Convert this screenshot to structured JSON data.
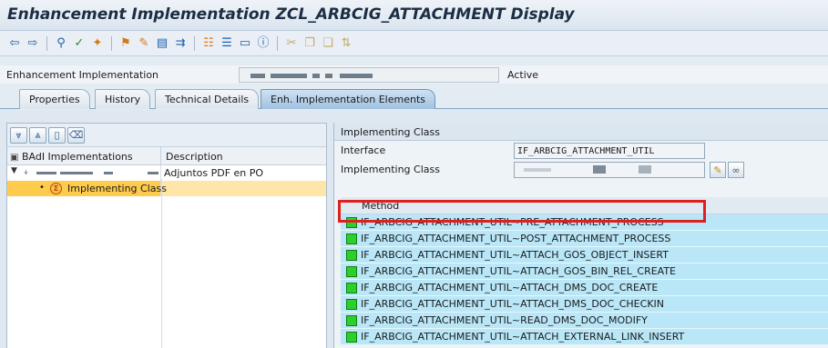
{
  "title": "Enhancement Implementation ZCL_ARBCIG_ATTACHMENT Display",
  "toolbar": {
    "icons": [
      "back-arrow-icon",
      "forward-arrow-icon",
      "other-object-icon",
      "check-icon",
      "activate-icon",
      "where-used-icon",
      "edit-pencil-icon",
      "display-change-icon",
      "transport-icon",
      "hierarchy-icon",
      "list-icon",
      "window-icon",
      "info-icon",
      "cut-icon",
      "copy-icon",
      "paste-icon",
      "sort-icon"
    ]
  },
  "header": {
    "label": "Enhancement Implementation",
    "status": "Active"
  },
  "tabs": [
    {
      "label": "Properties"
    },
    {
      "label": "History"
    },
    {
      "label": "Technical Details"
    },
    {
      "label": "Enh. Implementation Elements"
    }
  ],
  "left_panel": {
    "col_badi": "BAdI Implementations",
    "col_desc": "Description",
    "row1_desc": "Adjuntos PDF en PO",
    "row2_label": "Implementing Class"
  },
  "right_panel": {
    "title": "Implementing Class",
    "interface_label": "Interface",
    "interface_value": "IF_ARBCIG_ATTACHMENT_UTIL",
    "impl_class_label": "Implementing Class",
    "method_header": "Method",
    "methods": [
      "IF_ARBCIG_ATTACHMENT_UTIL~PRE_ATTACHMENT_PROCESS",
      "IF_ARBCIG_ATTACHMENT_UTIL~POST_ATTACHMENT_PROCESS",
      "IF_ARBCIG_ATTACHMENT_UTIL~ATTACH_GOS_OBJECT_INSERT",
      "IF_ARBCIG_ATTACHMENT_UTIL~ATTACH_GOS_BIN_REL_CREATE",
      "IF_ARBCIG_ATTACHMENT_UTIL~ATTACH_DMS_DOC_CREATE",
      "IF_ARBCIG_ATTACHMENT_UTIL~ATTACH_DMS_DOC_CHECKIN",
      "IF_ARBCIG_ATTACHMENT_UTIL~READ_DMS_DOC_MODIFY",
      "IF_ARBCIG_ATTACHMENT_UTIL~ATTACH_EXTERNAL_LINK_INSERT"
    ]
  },
  "colors": {
    "highlight_border": "#e02020",
    "method_row_bg": "#b9e7f8",
    "status_green": "#2bd12b",
    "selected_row": "#ffcb4c"
  }
}
